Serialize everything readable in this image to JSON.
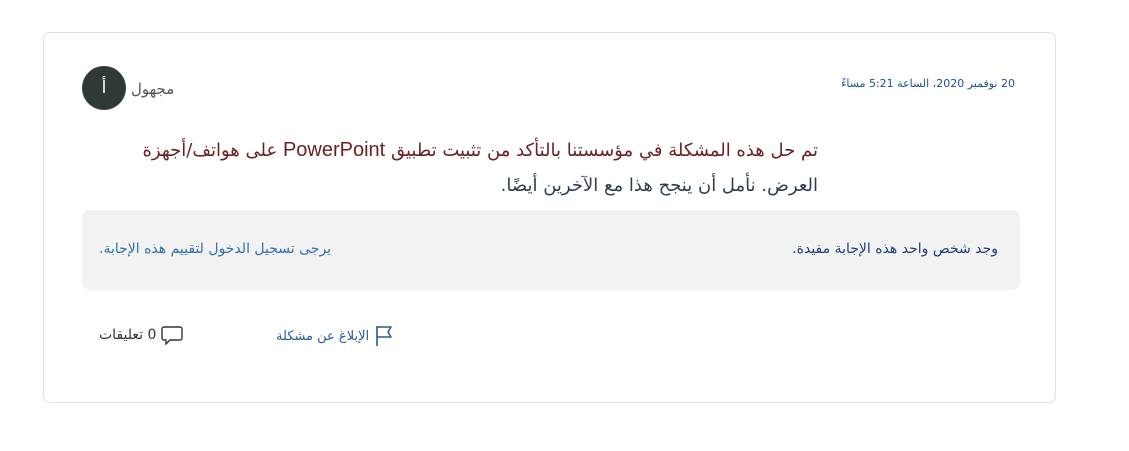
{
  "post": {
    "avatar_letter": "أ",
    "author": "مجهول",
    "date": "20 نوفمبر 2020، الساعة 5:21 مساءً",
    "body_line1_part1": "تم حل هذه المشكلة في مؤسستنا بالتأكد من تثبيت تطبيق",
    "body_line1_app": "PowerPoint",
    "body_line1_part2": "على هواتف/أجهزة",
    "body_line2": "العرض. نأمل أن ينجح هذا مع الآخرين أيضًا."
  },
  "feedback": {
    "helpful_text": "وجد شخص واحد هذه الإجابة مفيدة.",
    "login_text": "يرجى تسجيل الدخول لتقييم هذه الإجابة."
  },
  "actions": {
    "comments_label": "0 تعليقات",
    "comment_icon": "comment-bubble",
    "report_label": "الإبلاغ عن مشكلة",
    "report_icon": "flag"
  },
  "colors": {
    "avatar_bg": "#2f3b32",
    "body_highlight": "#6b2121",
    "link": "#2f6fb3",
    "feedback_bg": "#f2f2f2"
  }
}
